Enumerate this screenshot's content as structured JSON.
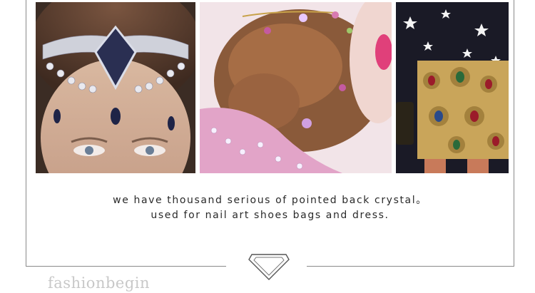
{
  "caption": {
    "line1": "we have thousand serious of pointed back crystal。",
    "line2": "used for nail art shoes bags and dress."
  },
  "watermark": "fashionbegin",
  "photos": [
    {
      "icon": "model-headpiece-photo"
    },
    {
      "icon": "model-hair-jewelry-photo"
    },
    {
      "icon": "model-jeweled-skirt-photo"
    }
  ],
  "colors": {
    "frame": "#8a8a8a",
    "caption_text": "#2a2a2a",
    "watermark": "#c8c8c8"
  }
}
